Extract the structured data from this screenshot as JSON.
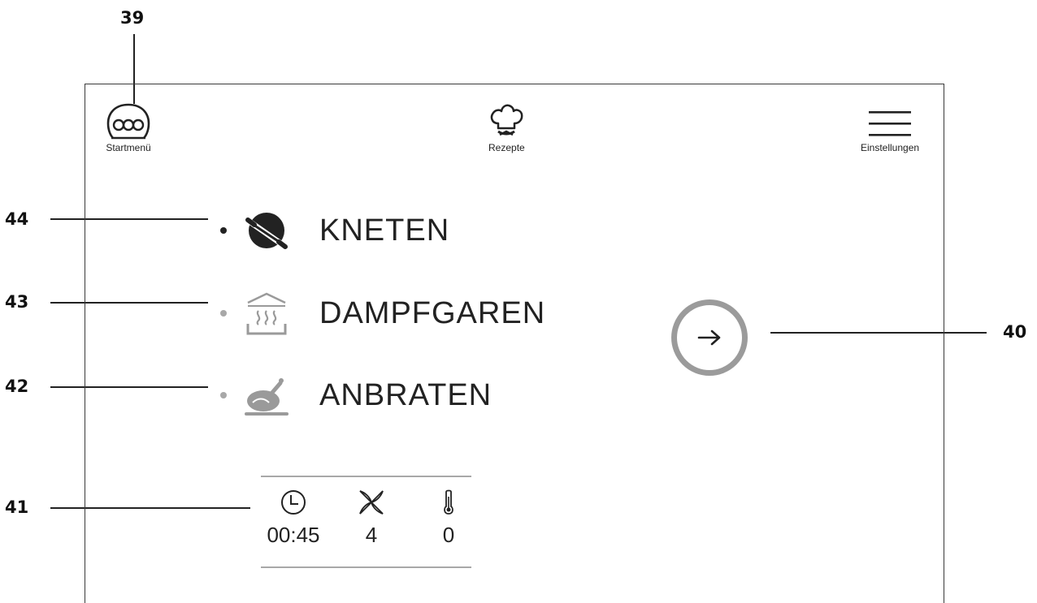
{
  "top_nav": {
    "start": {
      "label": "Startmenü",
      "icon": "three-dots-circle-icon"
    },
    "recipes": {
      "label": "Rezepte",
      "icon": "chef-hat-icon"
    },
    "settings": {
      "label": "Einstellungen",
      "icon": "hamburger-menu-icon"
    }
  },
  "modes": [
    {
      "label": "KNETEN",
      "icon": "kneading-icon",
      "active": true
    },
    {
      "label": "DAMPFGAREN",
      "icon": "steam-icon",
      "active": false
    },
    {
      "label": "ANBRATEN",
      "icon": "roast-chicken-icon",
      "active": false
    }
  ],
  "start_button": {
    "icon": "arrow-right-icon"
  },
  "settings_panel": {
    "time": {
      "value": "00:45",
      "icon": "clock-icon"
    },
    "speed": {
      "value": "4",
      "icon": "blade-icon"
    },
    "temperature": {
      "value": "0",
      "icon": "thermometer-icon"
    }
  },
  "callouts": {
    "n39": "39",
    "n40": "40",
    "n41": "41",
    "n42": "42",
    "n43": "43",
    "n44": "44"
  },
  "colors": {
    "active_dot": "#222222",
    "inactive_dot": "#a8a8a8",
    "start_ring": "#9b9b9b",
    "icon_gray": "#9a9a9a"
  }
}
